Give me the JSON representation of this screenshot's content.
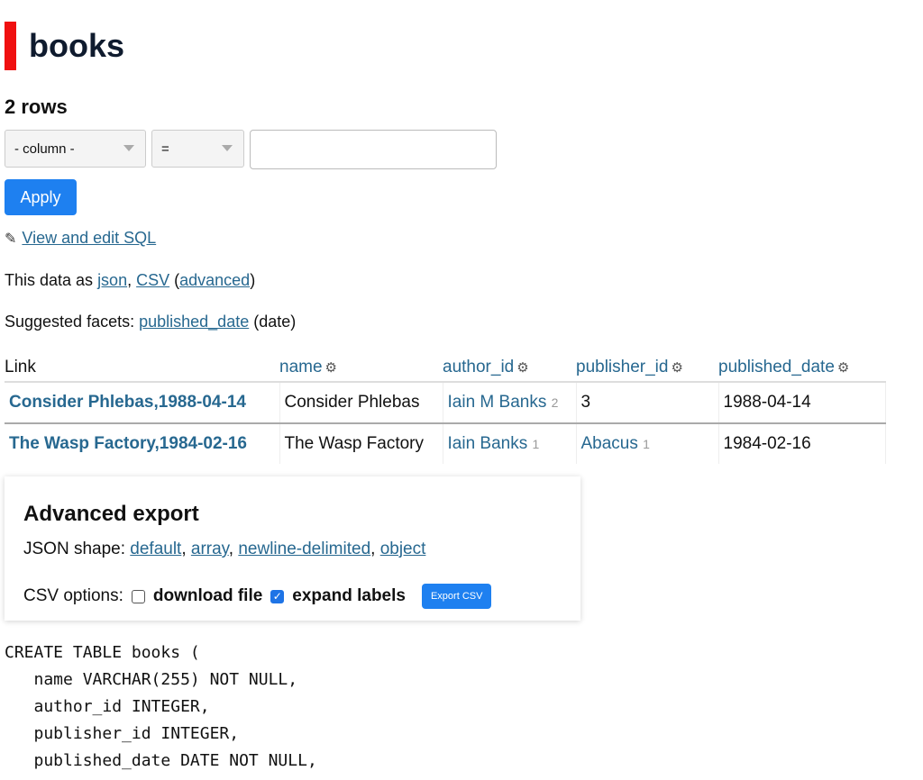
{
  "page": {
    "title": "books",
    "row_count": "2 rows"
  },
  "filter": {
    "column_placeholder": "- column -",
    "operator": "=",
    "value": "",
    "apply_label": "Apply"
  },
  "links": {
    "view_sql": "View and edit SQL",
    "data_as_prefix": "This data as ",
    "json": "json",
    "csv": "CSV",
    "advanced": "advanced",
    "suggested_prefix": "Suggested facets: ",
    "facet": "published_date",
    "facet_suffix": " (date)"
  },
  "table": {
    "headers": [
      "Link",
      "name",
      "author_id",
      "publisher_id",
      "published_date"
    ],
    "rows": [
      {
        "link": "Consider Phlebas,1988-04-14",
        "name": "Consider Phlebas",
        "author": "Iain M Banks",
        "author_count": "2",
        "publisher": "3",
        "publisher_count": "",
        "date": "1988-04-14"
      },
      {
        "link": "The Wasp Factory,1984-02-16",
        "name": "The Wasp Factory",
        "author": "Iain Banks",
        "author_count": "1",
        "publisher": "Abacus",
        "publisher_count": "1",
        "date": "1984-02-16"
      }
    ]
  },
  "export": {
    "title": "Advanced export",
    "json_label": "JSON shape: ",
    "json_options": [
      "default",
      "array",
      "newline-delimited",
      "object"
    ],
    "csv_label": "CSV options:",
    "download_file": "download file",
    "download_checked": false,
    "expand_labels": "expand labels",
    "expand_checked": true,
    "export_button": "Export CSV"
  },
  "sql": "CREATE TABLE books (\n   name VARCHAR(255) NOT NULL,\n   author_id INTEGER,\n   publisher_id INTEGER,\n   published_date DATE NOT NULL,"
}
